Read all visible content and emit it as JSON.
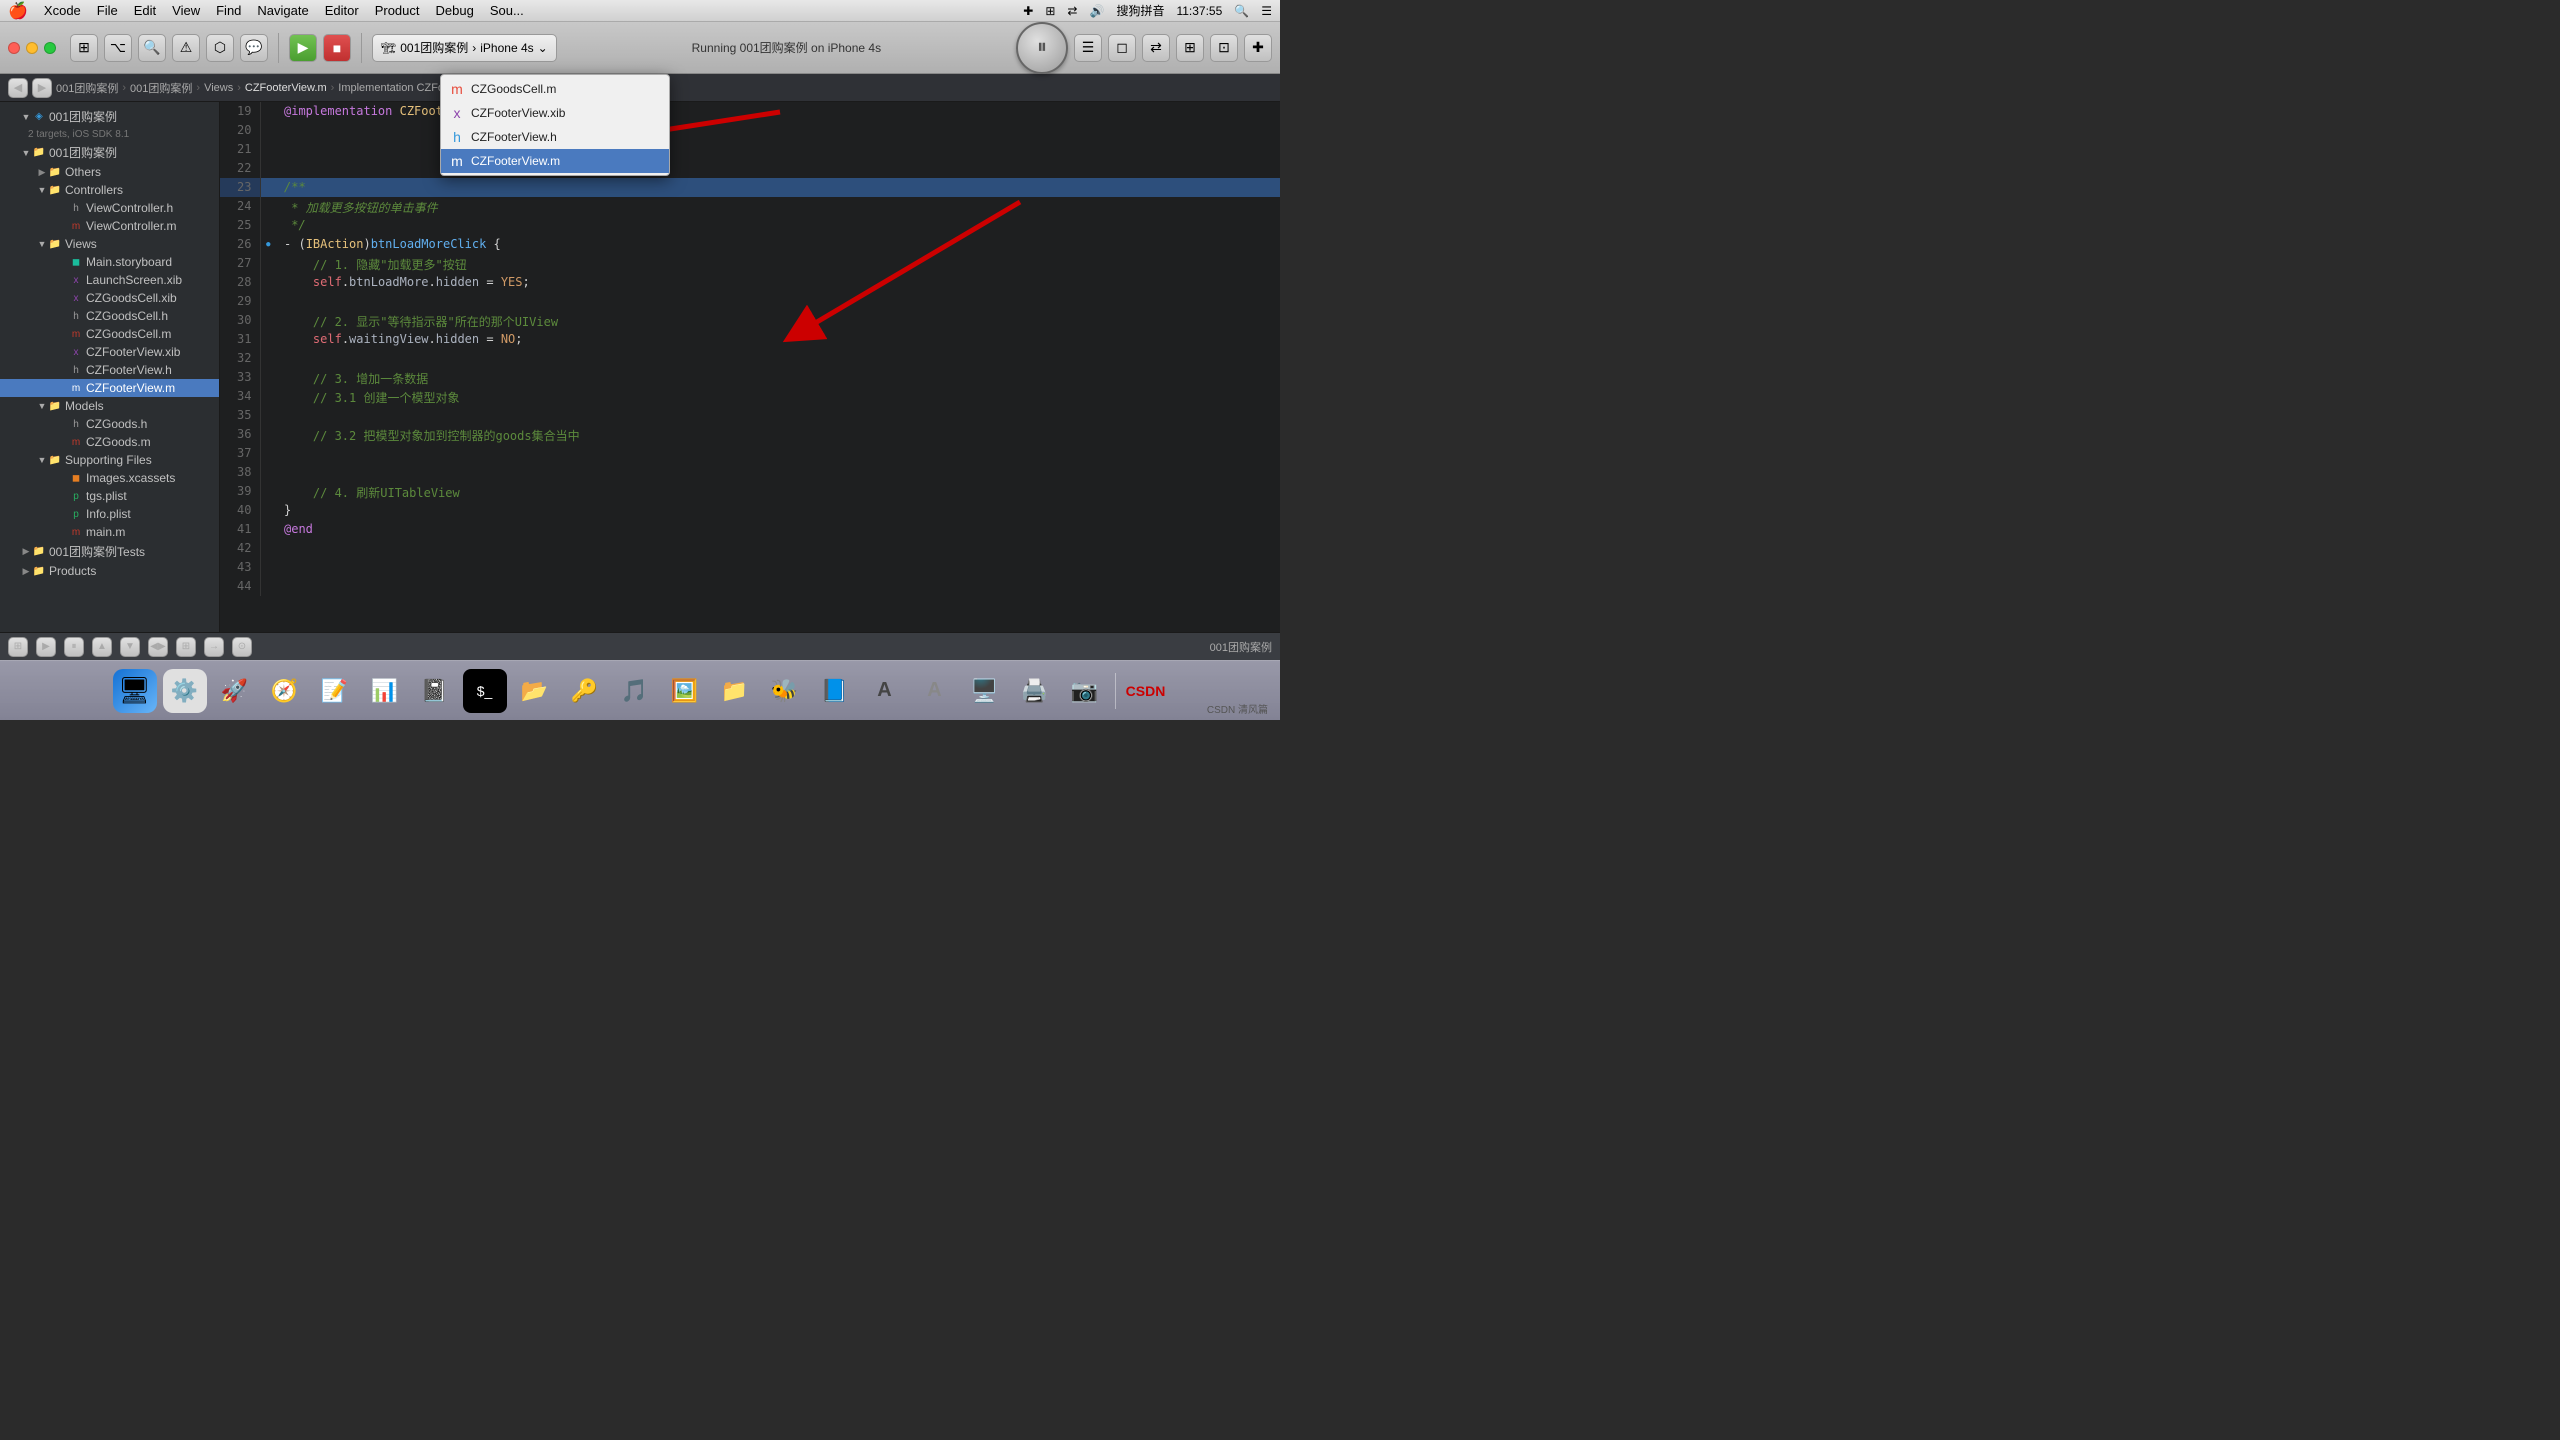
{
  "menubar": {
    "apple": "🍎",
    "items": [
      "Xcode",
      "File",
      "Edit",
      "View",
      "Find",
      "Navigate",
      "Editor",
      "Product",
      "Debug",
      "Source Control"
    ],
    "right": {
      "icons": [
        "✚",
        "⊞",
        "⇄"
      ],
      "volume": "🔊",
      "input": "搜狗拼音",
      "time": "11:37:55",
      "search": "🔍",
      "list": "☰"
    }
  },
  "toolbar": {
    "run_label": "▶",
    "stop_label": "■",
    "scheme": "001团购案例",
    "device": "iPhone 4s",
    "status": "Running 001团购案例 on iPhone 4s",
    "pause_icon": "⏸"
  },
  "breadcrumb": {
    "items": [
      "001团购案例",
      "001团购案例",
      "Views",
      "CZFooterView.m"
    ],
    "separator": "›"
  },
  "sidebar": {
    "project_name": "001团购案例",
    "project_subtitle": "2 targets, iOS SDK 8.1",
    "groups": [
      {
        "name": "001团购案例",
        "type": "group",
        "indent": 1,
        "children": [
          {
            "name": "Others",
            "type": "group",
            "indent": 2
          },
          {
            "name": "Controllers",
            "type": "group",
            "indent": 2,
            "children": [
              {
                "name": "ViewController.h",
                "type": "h",
                "indent": 3
              },
              {
                "name": "ViewController.m",
                "type": "m",
                "indent": 3
              }
            ]
          },
          {
            "name": "Views",
            "type": "group",
            "indent": 2,
            "children": [
              {
                "name": "Main.storyboard",
                "type": "storyboard",
                "indent": 3
              },
              {
                "name": "LaunchScreen.xib",
                "type": "xib",
                "indent": 3
              },
              {
                "name": "CZGoodsCell.xib",
                "type": "xib",
                "indent": 3
              },
              {
                "name": "CZGoodsCell.h",
                "type": "h",
                "indent": 3
              },
              {
                "name": "CZGoodsCell.m",
                "type": "m",
                "indent": 3
              },
              {
                "name": "CZFooterView.xib",
                "type": "xib",
                "indent": 3
              },
              {
                "name": "CZFooterView.h",
                "type": "h",
                "indent": 3
              },
              {
                "name": "CZFooterView.m",
                "type": "m",
                "indent": 3,
                "selected": true
              }
            ]
          },
          {
            "name": "Models",
            "type": "group",
            "indent": 2,
            "children": [
              {
                "name": "CZGoods.h",
                "type": "h",
                "indent": 3
              },
              {
                "name": "CZGoods.m",
                "type": "m",
                "indent": 3
              }
            ]
          },
          {
            "name": "Supporting Files",
            "type": "group",
            "indent": 2,
            "children": [
              {
                "name": "Images.xcassets",
                "type": "xcassets",
                "indent": 3
              },
              {
                "name": "tgs.plist",
                "type": "plist",
                "indent": 3
              },
              {
                "name": "Info.plist",
                "type": "plist",
                "indent": 3
              },
              {
                "name": "main.m",
                "type": "m",
                "indent": 3
              }
            ]
          }
        ]
      },
      {
        "name": "001团购案例Tests",
        "type": "group",
        "indent": 1
      },
      {
        "name": "Products",
        "type": "group",
        "indent": 1
      }
    ]
  },
  "code": {
    "filename": "CZFooterView.m",
    "header_text": "@implementation CZFooterView",
    "lines": [
      {
        "num": 19,
        "content": "@implementation CZFooterView",
        "highlight": false,
        "type": "impl"
      },
      {
        "num": 20,
        "content": "",
        "highlight": false
      },
      {
        "num": 21,
        "content": "",
        "highlight": false
      },
      {
        "num": 22,
        "content": "",
        "highlight": false
      },
      {
        "num": 23,
        "content": "/**",
        "highlight": true,
        "type": "comment"
      },
      {
        "num": 24,
        "content": " * 加载更多按钮的单击事件",
        "highlight": false,
        "type": "comment"
      },
      {
        "num": 25,
        "content": " */",
        "highlight": false,
        "type": "comment"
      },
      {
        "num": 26,
        "content": "- (IBAction)btnLoadMoreClick {",
        "highlight": false,
        "type": "method"
      },
      {
        "num": 27,
        "content": "    // 1. 隐藏\"加载更多\"按钮",
        "highlight": false,
        "type": "comment"
      },
      {
        "num": 28,
        "content": "    self.btnLoadMore.hidden = YES;",
        "highlight": false,
        "type": "code"
      },
      {
        "num": 29,
        "content": "",
        "highlight": false
      },
      {
        "num": 30,
        "content": "    // 2. 显示\"等待指示器\"所在的那个UIView",
        "highlight": false,
        "type": "comment"
      },
      {
        "num": 31,
        "content": "    self.waitingView.hidden = NO;",
        "highlight": false,
        "type": "code"
      },
      {
        "num": 32,
        "content": "",
        "highlight": false
      },
      {
        "num": 33,
        "content": "    // 3. 增加一条数据",
        "highlight": false,
        "type": "comment"
      },
      {
        "num": 34,
        "content": "    // 3.1 创建一个模型对象",
        "highlight": false,
        "type": "comment"
      },
      {
        "num": 35,
        "content": "",
        "highlight": false
      },
      {
        "num": 36,
        "content": "    // 3.2 把模型对象加到控制器的goods集合当中",
        "highlight": false,
        "type": "comment"
      },
      {
        "num": 37,
        "content": "",
        "highlight": false
      },
      {
        "num": 38,
        "content": "",
        "highlight": false
      },
      {
        "num": 39,
        "content": "    // 4. 刷新UITableView",
        "highlight": false,
        "type": "comment"
      },
      {
        "num": 40,
        "content": "}",
        "highlight": false,
        "type": "brace"
      },
      {
        "num": 41,
        "content": "@end",
        "highlight": false,
        "type": "at"
      },
      {
        "num": 42,
        "content": "",
        "highlight": false
      },
      {
        "num": 43,
        "content": "",
        "highlight": false
      },
      {
        "num": 44,
        "content": "",
        "highlight": false
      }
    ]
  },
  "dropdown": {
    "items": [
      {
        "name": "CZGoodsCell.m",
        "type": "m",
        "icon": "m"
      },
      {
        "name": "CZFooterView.xib",
        "type": "xib",
        "icon": "xib"
      },
      {
        "name": "CZFooterView.h",
        "type": "h",
        "icon": "h"
      },
      {
        "name": "CZFooterView.m",
        "type": "m",
        "icon": "m",
        "selected": true
      }
    ]
  },
  "bottom_bar": {
    "icons": [
      "⊞",
      "▶",
      "⏸",
      "▲",
      "▼",
      "◀▶",
      "⊞",
      "→",
      "⊙"
    ],
    "label": "001团购案例"
  },
  "dock": {
    "items": [
      {
        "name": "finder",
        "emoji": "😊",
        "color": "#1471d4"
      },
      {
        "name": "system-prefs",
        "emoji": "⚙️"
      },
      {
        "name": "launchpad",
        "emoji": "🚀"
      },
      {
        "name": "safari",
        "emoji": "🧭"
      },
      {
        "name": "notes",
        "emoji": "📝"
      },
      {
        "name": "excel",
        "emoji": "📊"
      },
      {
        "name": "onenote",
        "emoji": "📓"
      },
      {
        "name": "terminal",
        "emoji": "⬛"
      },
      {
        "name": "ftp",
        "emoji": "📂"
      },
      {
        "name": "keychain",
        "emoji": "🔑"
      },
      {
        "name": "unknown1",
        "emoji": "🎵"
      },
      {
        "name": "unknown2",
        "emoji": "🖼️"
      },
      {
        "name": "filezilla",
        "emoji": "📁"
      },
      {
        "name": "unknown3",
        "emoji": "🐝"
      },
      {
        "name": "word",
        "emoji": "📘"
      },
      {
        "name": "font-book",
        "emoji": "🅰️"
      },
      {
        "name": "font-book2",
        "emoji": "🅰"
      },
      {
        "name": "unknown4",
        "emoji": "🖥️"
      },
      {
        "name": "unknown5",
        "emoji": "🖨️"
      },
      {
        "name": "camera",
        "emoji": "📷"
      },
      {
        "name": "csdn",
        "emoji": "📋"
      }
    ],
    "right_label": "CSDN 清风篇"
  }
}
